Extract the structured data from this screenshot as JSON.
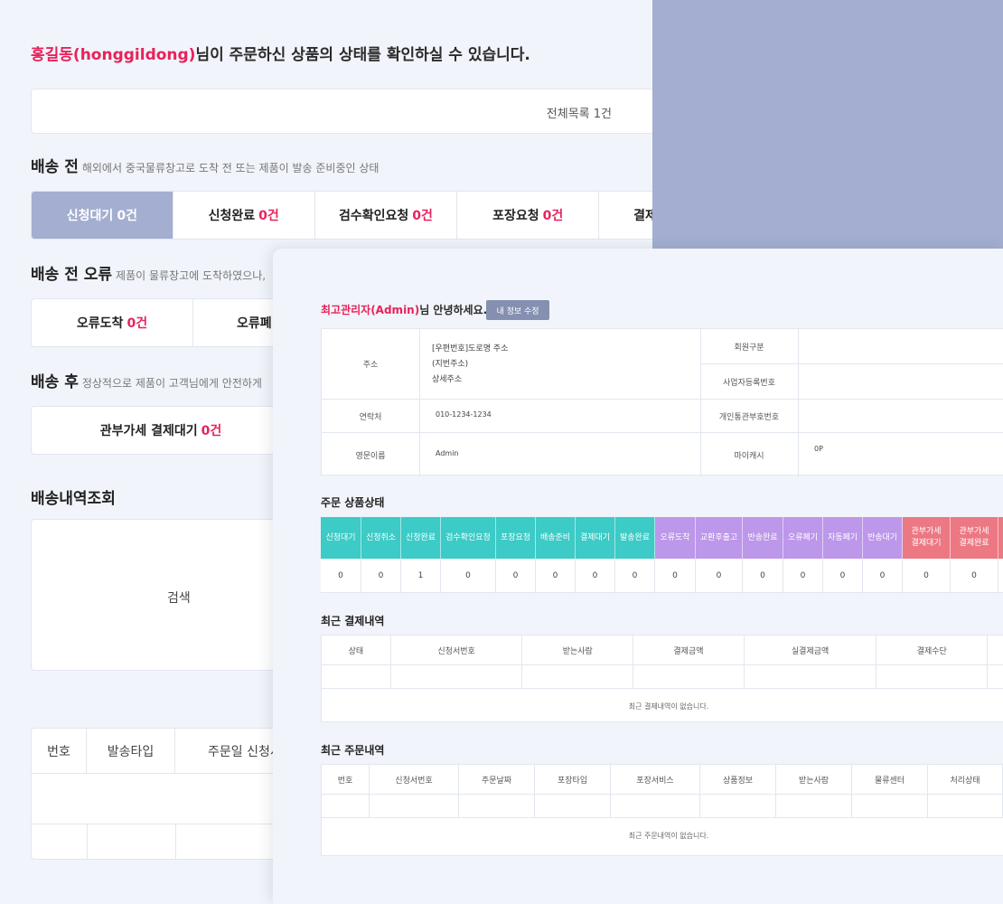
{
  "back": {
    "greeting": {
      "name": "홍길동(honggildong)",
      "suffix": "님이 주문하신 상품의 상태를 확인하실 수 있습니다."
    },
    "total": "전체목록 1건",
    "sections": {
      "before": {
        "title": "배송 전",
        "desc": "해외에서 중국물류창고로 도착 전 또는 제품이 발송 준비중인 상태"
      },
      "error": {
        "title": "배송 전 오류",
        "desc": "제품이 물류창고에 도착하였으나,"
      },
      "after": {
        "title": "배송 후",
        "desc": "정상적으로 제품이 고객님에게 안전하게"
      },
      "history": {
        "title": "배송내역조회"
      }
    },
    "tabs_before": [
      {
        "label": "신청대기",
        "count": "0건"
      },
      {
        "label": "신청완료",
        "count": "0건"
      },
      {
        "label": "검수확인요청",
        "count": "0건"
      },
      {
        "label": "포장요청",
        "count": "0건"
      },
      {
        "label": "결제",
        "count": ""
      }
    ],
    "tabs_error": [
      {
        "label": "오류도착",
        "count": "0건"
      },
      {
        "label": "오류폐",
        "count": ""
      }
    ],
    "tabs_after": [
      {
        "label": "관부가세 결제대기",
        "count": "0건"
      }
    ],
    "search_label": "검색",
    "table_headers": [
      "번호",
      "발송타입",
      "주문일 신청서"
    ]
  },
  "front": {
    "greeting": {
      "name": "최고관리자(Admin)",
      "suffix": "님 안녕하세요."
    },
    "edit_button": "내 정보 수정",
    "info": {
      "address_label": "주소",
      "address_lines": [
        "[우편번호]도로명 주소",
        "(지번주소)",
        "상세주소"
      ],
      "contact_label": "연락처",
      "contact_value": "010-1234-1234",
      "eng_name_label": "영문이름",
      "eng_name_value": "Admin",
      "member_type_label": "회원구분",
      "biz_no_label": "사업자등록번호",
      "customs_label": "개인통관부호번호",
      "cash_label": "마이캐시",
      "cash_value": "0P"
    },
    "status_title": "주문 상품상태",
    "status": [
      {
        "label": "신청대기",
        "value": "0",
        "color": "teal"
      },
      {
        "label": "신청취소",
        "value": "0",
        "color": "teal"
      },
      {
        "label": "신청완료",
        "value": "1",
        "color": "teal"
      },
      {
        "label": "검수확인요청",
        "value": "0",
        "color": "teal"
      },
      {
        "label": "포장요청",
        "value": "0",
        "color": "teal"
      },
      {
        "label": "배송준비",
        "value": "0",
        "color": "teal"
      },
      {
        "label": "결제대기",
        "value": "0",
        "color": "teal"
      },
      {
        "label": "발송완료",
        "value": "0",
        "color": "teal"
      },
      {
        "label": "오류도착",
        "value": "0",
        "color": "purple"
      },
      {
        "label": "교환후출고",
        "value": "0",
        "color": "purple"
      },
      {
        "label": "반송완료",
        "value": "0",
        "color": "purple"
      },
      {
        "label": "오류폐기",
        "value": "0",
        "color": "purple"
      },
      {
        "label": "자동폐기",
        "value": "0",
        "color": "purple"
      },
      {
        "label": "반송대기",
        "value": "0",
        "color": "purple"
      },
      {
        "label": "관부가세\n결제대기",
        "value": "0",
        "color": "red"
      },
      {
        "label": "관부가세\n결제완료",
        "value": "0",
        "color": "red"
      },
      {
        "label": "",
        "value": "",
        "color": "red"
      }
    ],
    "payments": {
      "title": "최근 결제내역",
      "headers": [
        "상태",
        "신청서번호",
        "받는사람",
        "결제금액",
        "실결제금액",
        "결제수단",
        ""
      ],
      "empty": "최근 결제내역이 없습니다."
    },
    "orders": {
      "title": "최근 주문내역",
      "headers": [
        "번호",
        "신청서번호",
        "주문날짜",
        "포장타입",
        "포장서비스",
        "상품정보",
        "받는사람",
        "물류센터",
        "처리상태"
      ],
      "empty": "최근 주문내역이 없습니다."
    }
  }
}
